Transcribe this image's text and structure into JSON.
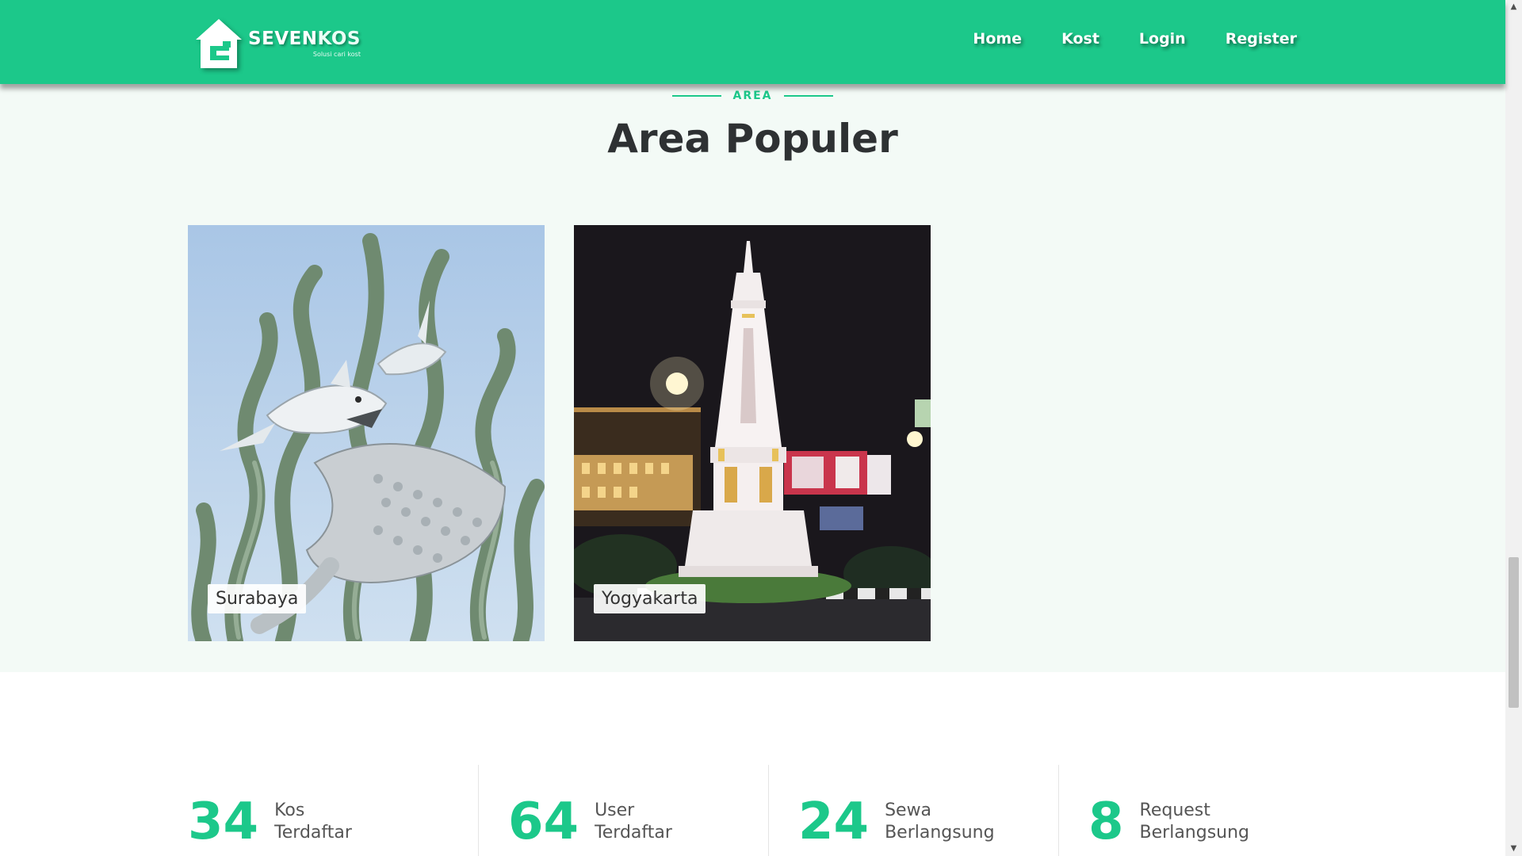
{
  "brand": {
    "name_part1": "SEVEN",
    "name_part2": "KOS",
    "tagline": "Solusi cari kost"
  },
  "nav": {
    "items": [
      {
        "label": "Home"
      },
      {
        "label": "Kost"
      },
      {
        "label": "Login"
      },
      {
        "label": "Register"
      }
    ]
  },
  "area_section": {
    "eyebrow": "AREA",
    "title": "Area Populer",
    "cards": [
      {
        "label": "Surabaya"
      },
      {
        "label": "Yogyakarta"
      }
    ]
  },
  "stats": [
    {
      "number": "34",
      "label_line1": "Kos",
      "label_line2": "Terdaftar"
    },
    {
      "number": "64",
      "label_line1": "User",
      "label_line2": "Terdaftar"
    },
    {
      "number": "24",
      "label_line1": "Sewa",
      "label_line2": "Berlangsung"
    },
    {
      "number": "8",
      "label_line1": "Request",
      "label_line2": "Berlangsung"
    }
  ],
  "colors": {
    "accent": "#1cc88a",
    "section_bg": "#f3faf6",
    "title": "#2e3133"
  }
}
